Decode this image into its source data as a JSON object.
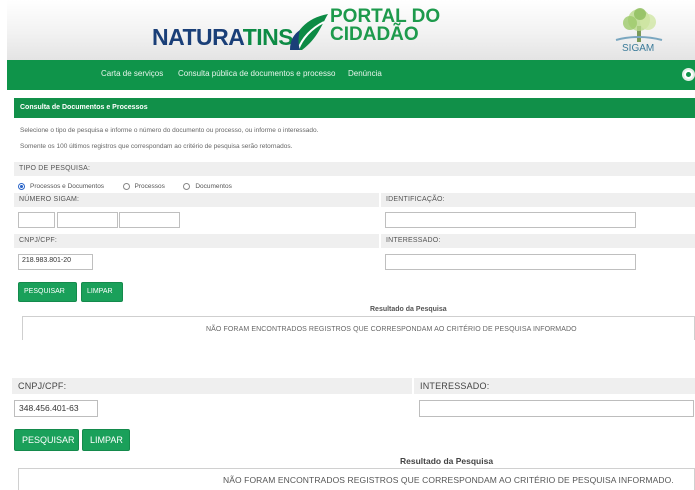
{
  "header": {
    "logo_part1": "NATURA",
    "logo_part2": "TINS",
    "portal_line1": "PORTAL DO",
    "portal_line2": "CIDADÃO",
    "sigam_label": "SIGAM"
  },
  "nav": {
    "items": [
      {
        "label": "Carta de serviços"
      },
      {
        "label": "Consulta pública de documentos e processo"
      },
      {
        "label": "Denúncia"
      }
    ]
  },
  "form": {
    "panel_title": "Consulta de Documentos e Processos",
    "instruction_1": "Selecione o tipo de pesquisa e informe o número do documento ou processo, ou informe o interessado.",
    "instruction_2": "Somente os 100 últimos registros que correspondam ao critério de pesquisa serão retornados.",
    "tipo_label": "TIPO DE PESQUISA:",
    "radios": [
      {
        "label": "Processos e Documentos",
        "checked": true
      },
      {
        "label": "Processos",
        "checked": false
      },
      {
        "label": "Documentos",
        "checked": false
      }
    ],
    "numero_label": "NÚMERO SIGAM:",
    "identificacao_label": "IDENTIFICAÇÃO:",
    "cnpj_label": "CNPJ/CPF:",
    "cnpj_value": "218.983.801-20",
    "interessado_label": "INTERESSADO:",
    "pesquisar_label": "PESQUISAR",
    "limpar_label": "LIMPAR",
    "result_title": "Resultado da Pesquisa",
    "result_message": "NÃO FORAM ENCONTRADOS REGISTROS QUE CORRESPONDAM AO CRITÉRIO DE PESQUISA INFORMADO"
  },
  "zoom": {
    "cnpj_label": "CNPJ/CPF:",
    "cnpj_value": "348.456.401-63",
    "interessado_label": "INTERESSADO:",
    "pesquisar_label": "PESQUISAR",
    "limpar_label": "LIMPAR",
    "result_title": "Resultado da Pesquisa",
    "result_message": "NÃO FORAM ENCONTRADOS REGISTROS QUE CORRESPONDAM AO CRITÉRIO DE PESQUISA INFORMADO."
  },
  "colors": {
    "brand_green": "#0f944a",
    "brand_blue": "#1a3f78",
    "button_green": "#1aa05a"
  }
}
